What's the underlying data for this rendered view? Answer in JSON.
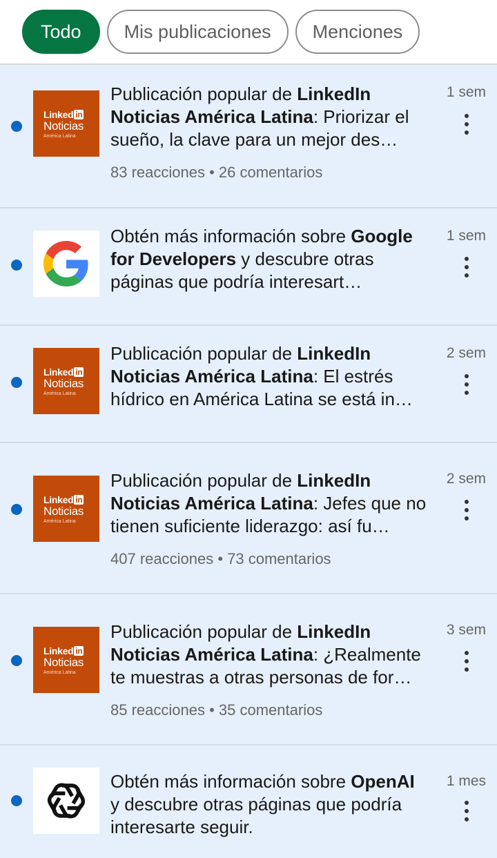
{
  "filters": [
    {
      "label": "Todo",
      "active": true
    },
    {
      "label": "Mis publicaciones",
      "active": false
    },
    {
      "label": "Menciones",
      "active": false
    }
  ],
  "logos": {
    "linkedin": {
      "top": "Linked",
      "badge": "in",
      "mid": "Noticias",
      "bot": "América Latina"
    }
  },
  "notifications": [
    {
      "logo": "linkedin-noticias",
      "pre": "Publicación popular de ",
      "bold": "LinkedIn Noticias América Latina",
      "post": ": Priorizar el sueño, la clave para un mejor des…",
      "meta": "83 reacciones • 26 comentarios",
      "time": "1 sem"
    },
    {
      "logo": "google",
      "pre": "Obtén más información sobre ",
      "bold": "Google for Developers",
      "post": " y descubre otras páginas que podría interesart…",
      "meta": "",
      "time": "1 sem"
    },
    {
      "logo": "linkedin-noticias",
      "pre": "Publicación popular de ",
      "bold": "LinkedIn Noticias América Latina",
      "post": ": El estrés hídrico en América Latina se está in…",
      "meta": "",
      "time": "2 sem"
    },
    {
      "logo": "linkedin-noticias",
      "pre": "Publicación popular de ",
      "bold": "LinkedIn Noticias América Latina",
      "post": ": Jefes que no tienen suficiente liderazgo: así fu…",
      "meta": "407 reacciones • 73 comentarios",
      "time": "2 sem"
    },
    {
      "logo": "linkedin-noticias",
      "pre": "Publicación popular de ",
      "bold": "LinkedIn Noticias América Latina",
      "post": ": ¿Realmente te muestras a otras personas de for…",
      "meta": "85 reacciones • 35 comentarios",
      "time": "3 sem"
    },
    {
      "logo": "openai",
      "pre": "Obtén más información sobre ",
      "bold": "OpenAI",
      "post": " y descubre otras páginas que podría interesarte seguir.",
      "meta": "",
      "time": "1 mes"
    }
  ],
  "colors": {
    "accent": "#057642",
    "unread_dot": "#0a66c2",
    "unread_bg": "#e6f0fc",
    "linkedin_news_bg": "#c24b0a"
  }
}
